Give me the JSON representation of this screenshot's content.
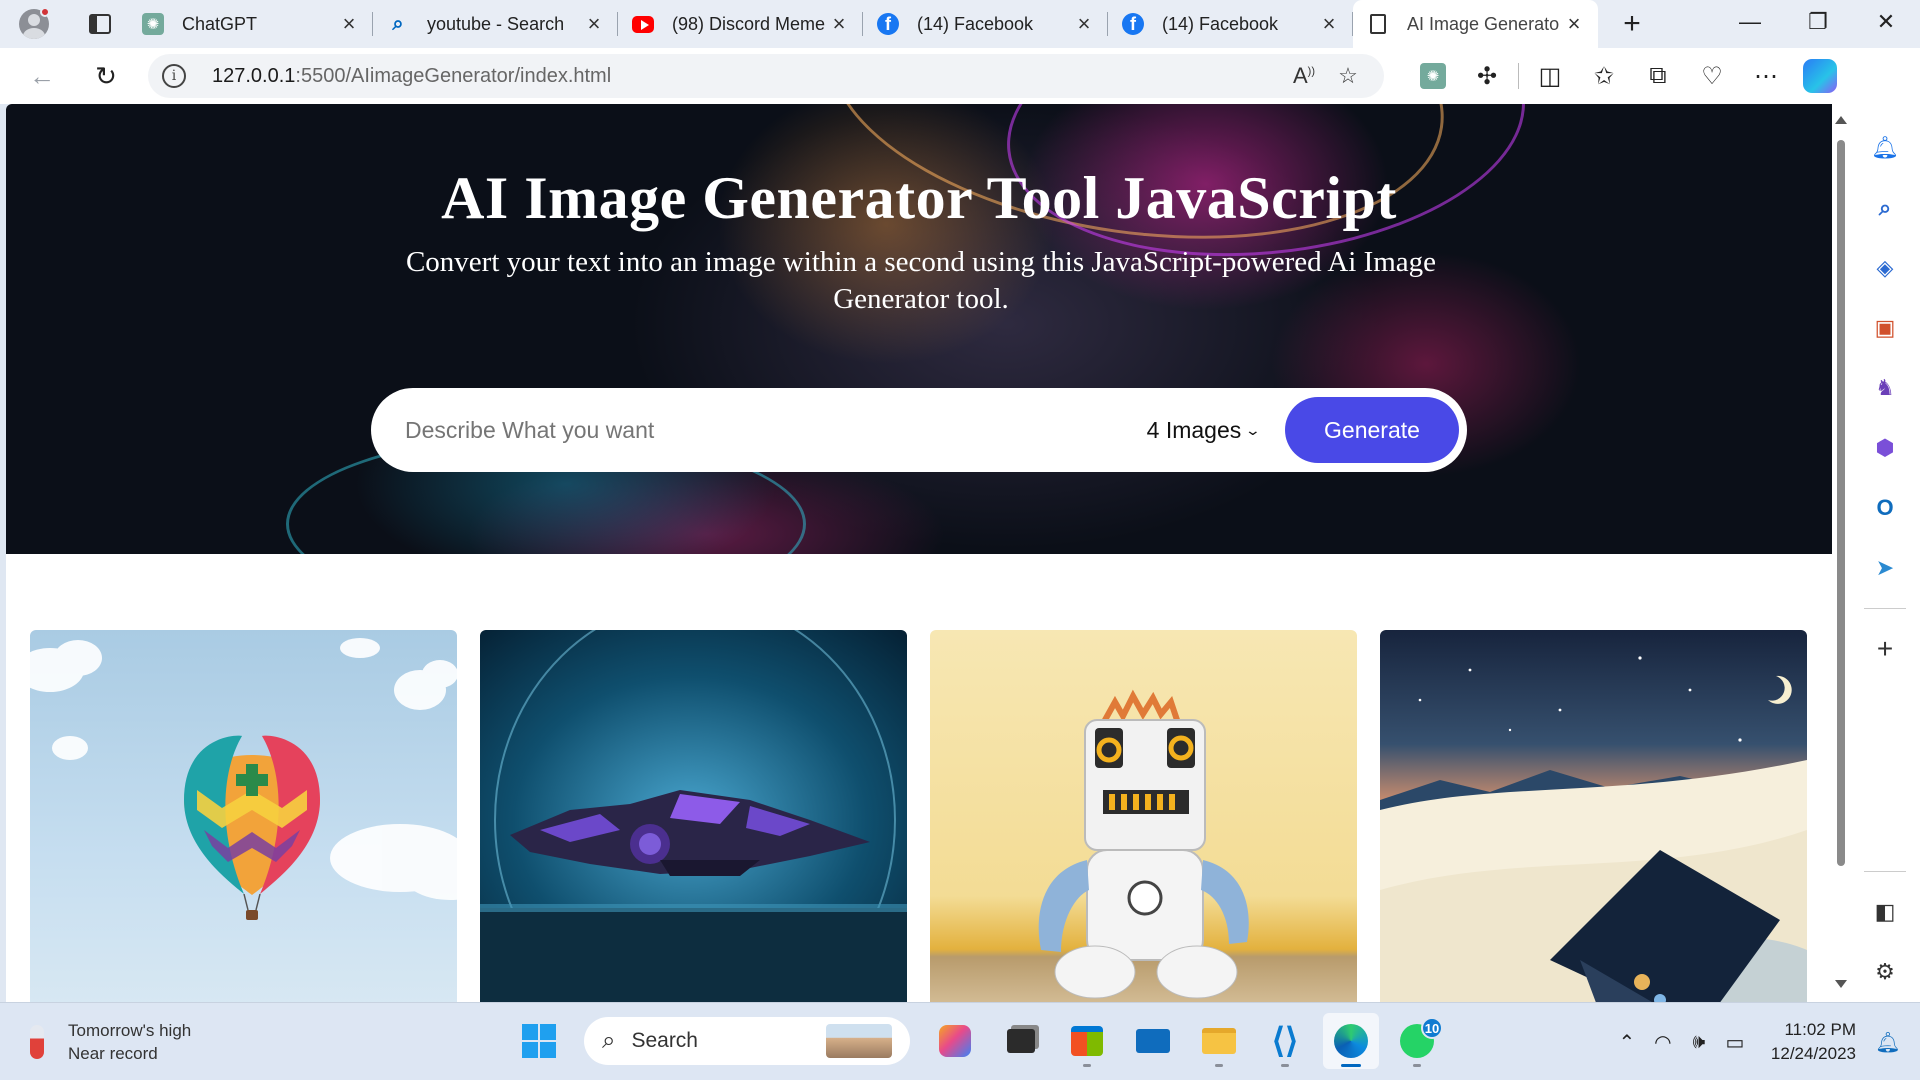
{
  "browser": {
    "tabs": [
      {
        "title": "ChatGPT",
        "icon": "chatgpt-icon",
        "active": false
      },
      {
        "title": "youtube - Search",
        "icon": "search-icon",
        "active": false
      },
      {
        "title": "(98) Discord Meme",
        "icon": "youtube-icon",
        "active": false
      },
      {
        "title": "(14) Facebook",
        "icon": "facebook-icon",
        "active": false
      },
      {
        "title": "(14) Facebook",
        "icon": "facebook-icon",
        "active": false
      },
      {
        "title": "AI Image Generato",
        "icon": "page-icon",
        "active": true
      }
    ],
    "address": {
      "host": "127.0.0.1",
      "path": ":5500/AIimageGenerator/index.html"
    }
  },
  "page": {
    "title": "AI Image Generator Tool JavaScript",
    "subtitle": "Convert your text into an image within a second using this JavaScript-powered Ai Image Generator tool.",
    "prompt_placeholder": "Describe What you want",
    "image_count": "4 Images",
    "generate_label": "Generate",
    "gallery": [
      {
        "subject": "hot-air-balloon"
      },
      {
        "subject": "spaceship"
      },
      {
        "subject": "plush-robot"
      },
      {
        "subject": "snowy-night-house"
      }
    ],
    "colors": {
      "accent": "#4949e7",
      "hero_bg": "#0b0f18"
    }
  },
  "taskbar": {
    "weather_line1": "Tomorrow's high",
    "weather_line2": "Near record",
    "search_placeholder": "Search",
    "whatsapp_badge": "10",
    "time": "11:02 PM",
    "date": "12/24/2023"
  }
}
